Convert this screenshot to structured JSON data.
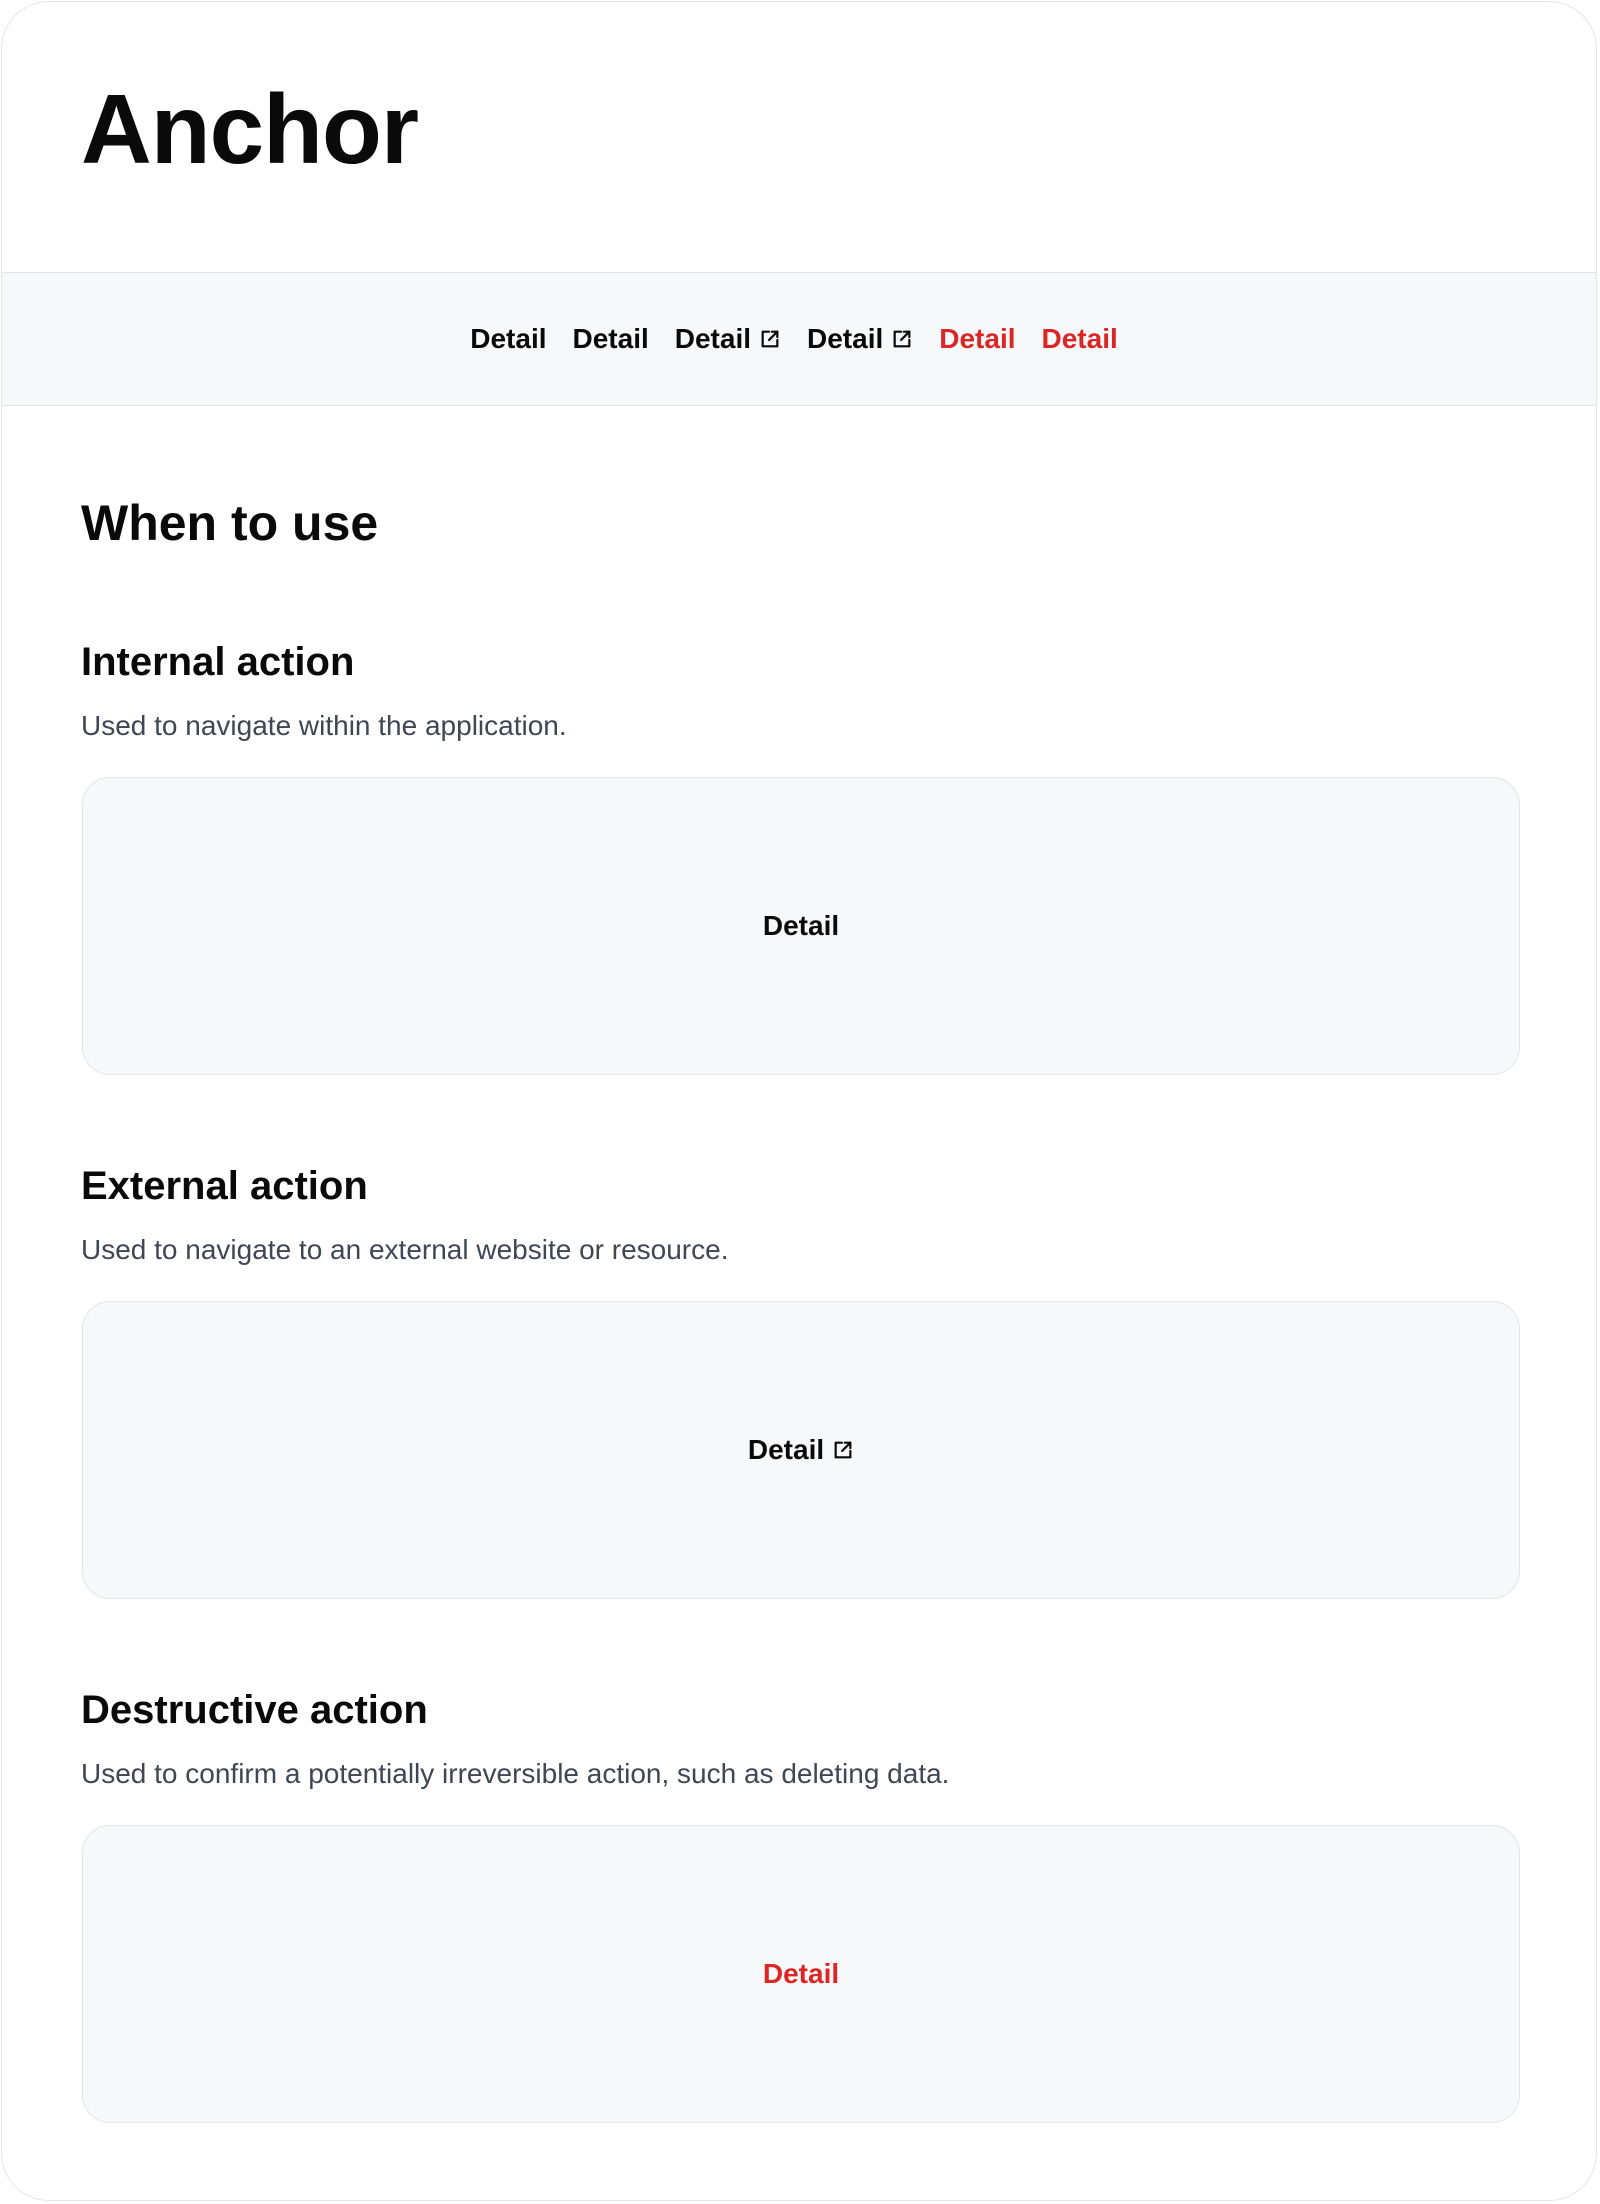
{
  "page": {
    "title": "Anchor"
  },
  "preview_strip": {
    "anchors": [
      {
        "label": "Detail",
        "variant": "internal",
        "external": false
      },
      {
        "label": "Detail",
        "variant": "internal",
        "external": false
      },
      {
        "label": "Detail",
        "variant": "external",
        "external": true
      },
      {
        "label": "Detail",
        "variant": "external",
        "external": true
      },
      {
        "label": "Detail",
        "variant": "destructive",
        "external": false
      },
      {
        "label": "Detail",
        "variant": "destructive",
        "external": false
      }
    ]
  },
  "when_to_use": {
    "heading": "When to use",
    "sections": [
      {
        "title": "Internal action",
        "description": "Used to navigate within the application.",
        "demo_label": "Detail"
      },
      {
        "title": "External action",
        "description": "Used to navigate to an external website or resource.",
        "demo_label": "Detail"
      },
      {
        "title": "Destructive action",
        "description": "Used to confirm a potentially irreversible action, such as deleting data.",
        "demo_label": "Detail"
      }
    ]
  },
  "colors": {
    "text": "#0a0a0a",
    "destructive": "#dc2626",
    "muted_text": "#3f4654",
    "panel_bg": "#f7f8fa",
    "border": "#e2e4e8"
  },
  "icons": {
    "external": "external-link-icon"
  }
}
